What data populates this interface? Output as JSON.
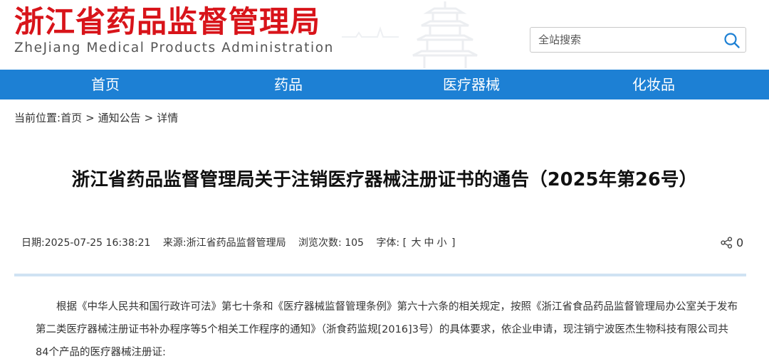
{
  "site": {
    "name_cn": "浙江省药品监督管理局",
    "name_en": "ZheJiang Medical Products Administration",
    "accent_color": "#d8141a",
    "nav_color": "#1d80d4"
  },
  "search": {
    "placeholder": "全站搜索",
    "icon": "search-icon"
  },
  "nav": {
    "items": [
      {
        "label": "首页"
      },
      {
        "label": "药品"
      },
      {
        "label": "医疗器械"
      },
      {
        "label": "化妆品"
      }
    ]
  },
  "breadcrumb": {
    "prefix": "当前位置:",
    "items": [
      "首页",
      "通知公告",
      "详情"
    ],
    "separator": ">"
  },
  "article": {
    "title": "浙江省药品监督管理局关于注销医疗器械注册证书的通告（2025年第26号）",
    "meta": {
      "date_label": "日期:",
      "date": "2025-07-25 16:38:21",
      "source_label": "来源:",
      "source": "浙江省药品监督管理局",
      "views_label": "浏览次数:",
      "views": "105",
      "font_label": "字体:",
      "font_open": "[",
      "font_large": "大",
      "font_medium": "中",
      "font_small": "小",
      "font_close": "]"
    },
    "share_icon": "share-icon",
    "share_count": "0",
    "body": "根据《中华人民共和国行政许可法》第七十条和《医疗器械监督管理条例》第六十六条的相关规定，按照《浙江省食品药品监督管理局办公室关于发布第二类医疗器械注册证书补办程序等5个相关工作程序的通知》（浙食药监规[2016]3号）的具体要求，依企业申请，现注销宁波医杰生物科技有限公司共84个产品的医疗器械注册证:"
  }
}
